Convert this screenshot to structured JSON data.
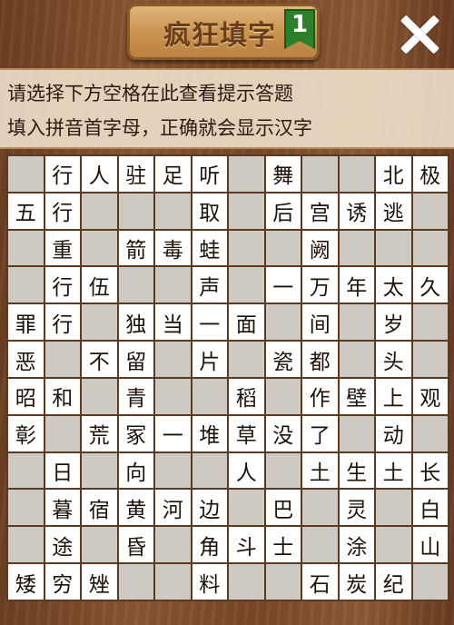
{
  "header": {
    "title": "疯狂填字",
    "level": "1"
  },
  "hints": {
    "line1": "请选择下方空格在此查看提示答题",
    "line2": "填入拼音首字母，正确就会显示汉字"
  },
  "grid": {
    "rows": [
      [
        "",
        "行",
        "人",
        "驻",
        "足",
        "听",
        "",
        "舞",
        "",
        "",
        "北",
        "极"
      ],
      [
        "五",
        "行",
        "",
        "",
        "",
        "取",
        "",
        "后",
        "宫",
        "诱",
        "逃",
        ""
      ],
      [
        "",
        "重",
        "",
        "箭",
        "毒",
        "蛙",
        "",
        "",
        "阙",
        "",
        "",
        ""
      ],
      [
        "",
        "行",
        "伍",
        "",
        "",
        "声",
        "",
        "一",
        "万",
        "年",
        "太",
        "久"
      ],
      [
        "罪",
        "行",
        "",
        "独",
        "当",
        "一",
        "面",
        "",
        "间",
        "",
        "岁",
        ""
      ],
      [
        "恶",
        "",
        "不",
        "留",
        "",
        "片",
        "",
        "瓷",
        "都",
        "",
        "头",
        ""
      ],
      [
        "昭",
        "和",
        "",
        "青",
        "",
        "",
        "稻",
        "",
        "作",
        "壁",
        "上",
        "观"
      ],
      [
        "彰",
        "",
        "荒",
        "冢",
        "一",
        "堆",
        "草",
        "没",
        "了",
        "",
        "动",
        ""
      ],
      [
        "",
        "日",
        "",
        "向",
        "",
        "",
        "人",
        "",
        "土",
        "生",
        "土",
        "长"
      ],
      [
        "",
        "暮",
        "宿",
        "黄",
        "河",
        "边",
        "",
        "巴",
        "",
        "灵",
        "",
        "白"
      ],
      [
        "",
        "途",
        "",
        "昏",
        "",
        "角",
        "斗",
        "士",
        "",
        "涂",
        "",
        "山"
      ],
      [
        "矮",
        "穷",
        "矬",
        "",
        "",
        "料",
        "",
        "",
        "石",
        "炭",
        "纪",
        ""
      ]
    ],
    "cell_types": [
      [
        "g",
        "w",
        "w",
        "w",
        "w",
        "w",
        "g",
        "w",
        "g",
        "g",
        "w",
        "w"
      ],
      [
        "w",
        "w",
        "g",
        "g",
        "g",
        "w",
        "g",
        "w",
        "w",
        "w",
        "w",
        "g"
      ],
      [
        "g",
        "w",
        "g",
        "w",
        "w",
        "w",
        "g",
        "g",
        "w",
        "g",
        "g",
        "g"
      ],
      [
        "g",
        "w",
        "w",
        "g",
        "g",
        "w",
        "g",
        "w",
        "w",
        "w",
        "w",
        "w"
      ],
      [
        "w",
        "w",
        "g",
        "w",
        "w",
        "w",
        "w",
        "g",
        "w",
        "g",
        "w",
        "g"
      ],
      [
        "w",
        "g",
        "w",
        "w",
        "g",
        "w",
        "g",
        "w",
        "w",
        "g",
        "w",
        "g"
      ],
      [
        "w",
        "w",
        "g",
        "w",
        "g",
        "g",
        "w",
        "g",
        "w",
        "w",
        "w",
        "w"
      ],
      [
        "w",
        "g",
        "w",
        "w",
        "w",
        "w",
        "w",
        "w",
        "w",
        "g",
        "w",
        "g"
      ],
      [
        "g",
        "w",
        "g",
        "w",
        "g",
        "g",
        "w",
        "g",
        "w",
        "w",
        "w",
        "w"
      ],
      [
        "g",
        "w",
        "w",
        "w",
        "w",
        "w",
        "g",
        "w",
        "g",
        "w",
        "g",
        "w"
      ],
      [
        "g",
        "w",
        "g",
        "w",
        "g",
        "w",
        "w",
        "w",
        "g",
        "w",
        "g",
        "w"
      ],
      [
        "w",
        "w",
        "w",
        "g",
        "g",
        "w",
        "g",
        "g",
        "w",
        "w",
        "w",
        "g"
      ]
    ]
  },
  "colors": {
    "wood": "#7a4a2a",
    "cell_white": "#ffffff",
    "cell_gray": "#cfc9c4",
    "badge_green": "#2f7f2a"
  }
}
